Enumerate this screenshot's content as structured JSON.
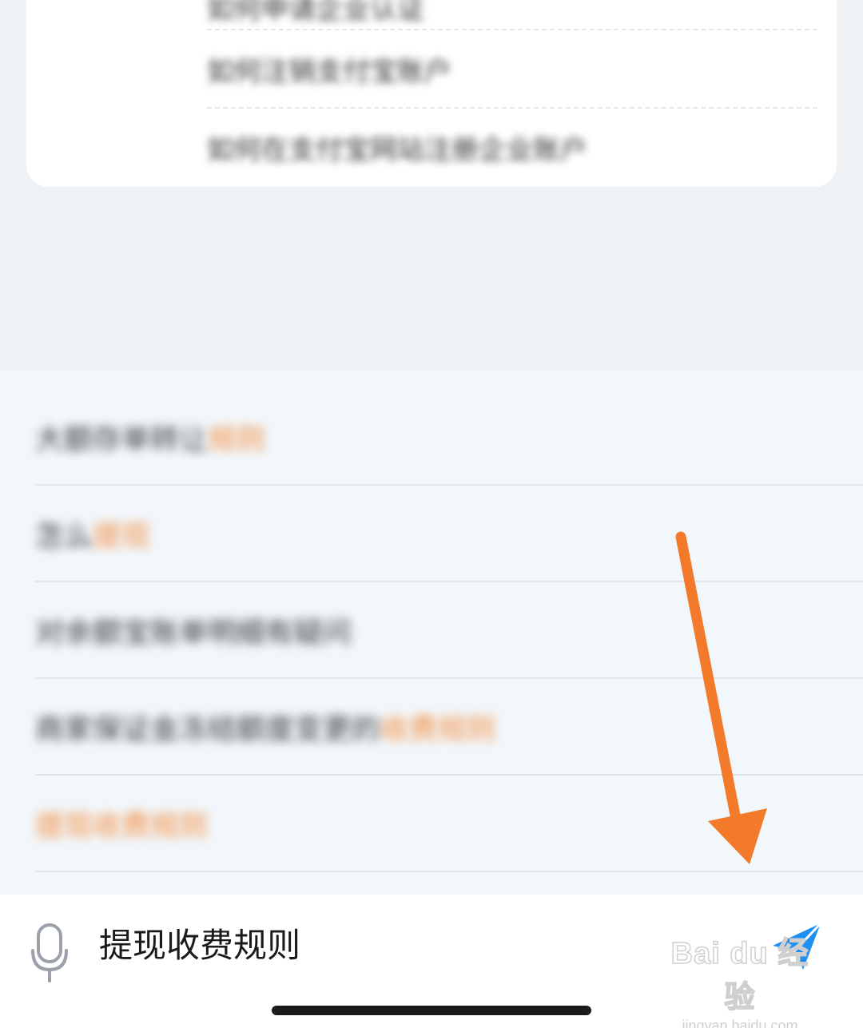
{
  "top_card": {
    "items": [
      "如何申请企业认证",
      "如何注销支付宝账户",
      "如何在支付宝网站注册企业账户"
    ]
  },
  "suggestions": [
    {
      "plain": "大额存单转让",
      "highlight": "规则"
    },
    {
      "plain": "怎么",
      "highlight": "提现"
    },
    {
      "plain": "对余额宝账单明细有疑问",
      "highlight": ""
    },
    {
      "plain": "商家保证金冻结额度变更的",
      "highlight": "收费规则"
    },
    {
      "plain": "",
      "highlight": "提现收费规则"
    }
  ],
  "input_bar": {
    "query": "提现收费规则",
    "mic_icon": "microphone-icon",
    "send_icon": "send-icon"
  },
  "annotation": {
    "color": "#f47a2b",
    "type": "arrow-down"
  },
  "watermark": {
    "logo": "Bai du 经验",
    "url": "jingyan.baidu.com"
  },
  "colors": {
    "background": "#f0f3f6",
    "highlight": "#f28a3a",
    "send": "#1f8ff2"
  }
}
